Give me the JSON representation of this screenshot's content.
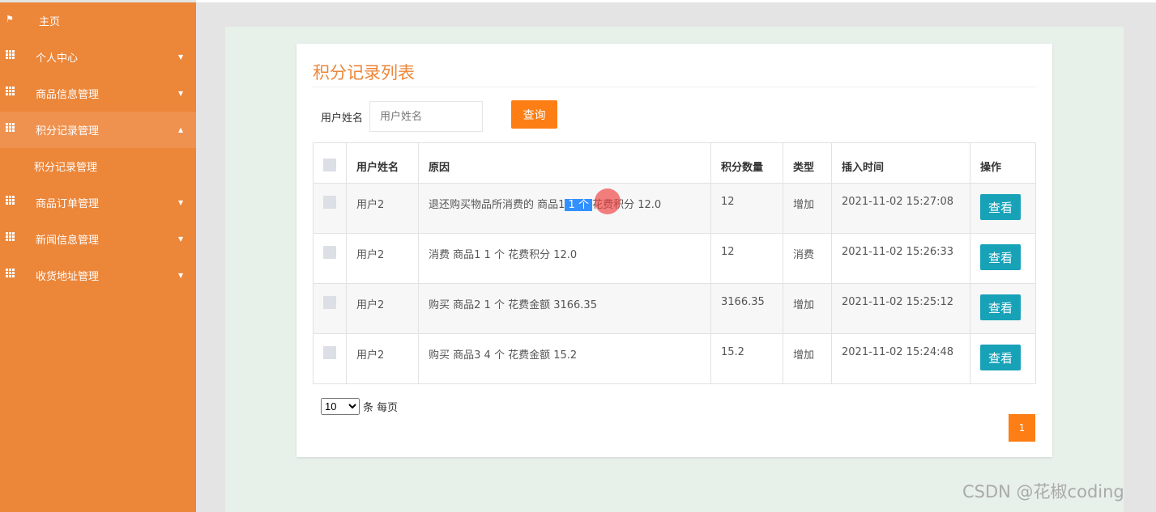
{
  "sidebar": {
    "items": [
      {
        "label": "主页",
        "icon": "flag-icon"
      },
      {
        "label": "个人中心",
        "icon": "grid-icon"
      },
      {
        "label": "商品信息管理",
        "icon": "grid-icon"
      },
      {
        "label": "积分记录管理",
        "icon": "grid-icon",
        "expanded": true
      },
      {
        "label": "积分记录管理",
        "sub": true
      },
      {
        "label": "商品订单管理",
        "icon": "grid-icon"
      },
      {
        "label": "新闻信息管理",
        "icon": "grid-icon"
      },
      {
        "label": "收货地址管理",
        "icon": "grid-icon"
      }
    ]
  },
  "page": {
    "title": "积分记录列表"
  },
  "search": {
    "label": "用户姓名",
    "placeholder": "用户姓名",
    "button": "查询"
  },
  "table": {
    "headers": [
      "用户姓名",
      "原因",
      "积分数量",
      "类型",
      "插入时间",
      "操作"
    ],
    "rows": [
      {
        "name": "用户2",
        "reason_a": "退还购买物品所消费的 商品1",
        "reason_sel": " 1 个 ",
        "reason_b": "花费积分 12.0",
        "points": "12",
        "type": "增加",
        "time": "2021-11-02 15:27:08",
        "action": "查看"
      },
      {
        "name": "用户2",
        "reason_a": "消费 商品1 1 个 花费积分 12.0",
        "reason_sel": "",
        "reason_b": "",
        "points": "12",
        "type": "消费",
        "time": "2021-11-02 15:26:33",
        "action": "查看"
      },
      {
        "name": "用户2",
        "reason_a": "购买 商品2 1 个 花费金额 3166.35",
        "reason_sel": "",
        "reason_b": "",
        "points": "3166.35",
        "type": "增加",
        "time": "2021-11-02 15:25:12",
        "action": "查看"
      },
      {
        "name": "用户2",
        "reason_a": "购买 商品3 4 个 花费金额 15.2",
        "reason_sel": "",
        "reason_b": "",
        "points": "15.2",
        "type": "增加",
        "time": "2021-11-02 15:24:48",
        "action": "查看"
      }
    ]
  },
  "pagination": {
    "page_size": "10",
    "per_page_label": "条 每页",
    "current_page": "1"
  },
  "watermark": "CSDN @花椒coding",
  "colors": {
    "sidebar": "#ec8639",
    "accent": "#fd7e14",
    "view_button": "#17a2b8"
  }
}
